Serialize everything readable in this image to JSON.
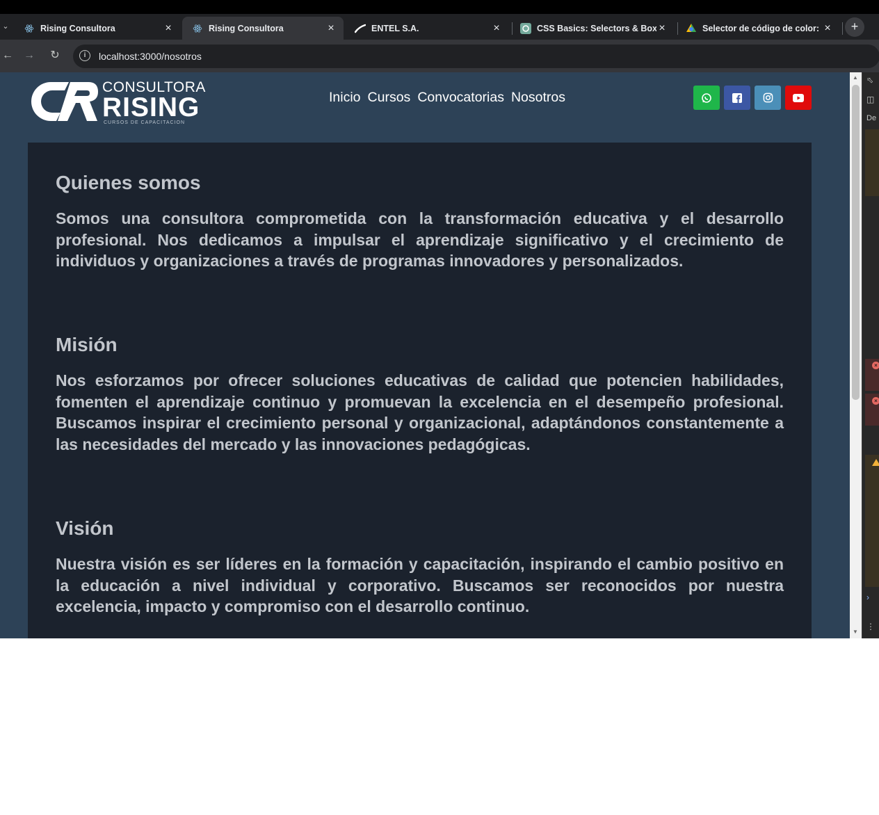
{
  "browser": {
    "tabs": [
      {
        "title": "Rising Consultora",
        "icon": "react-icon",
        "active": false
      },
      {
        "title": "Rising Consultora",
        "icon": "react-icon",
        "active": true
      },
      {
        "title": "ENTEL S.A.",
        "icon": "entel-icon",
        "active": false
      },
      {
        "title": "CSS Basics: Selectors & Box Mo",
        "icon": "chatgpt-icon",
        "active": false
      },
      {
        "title": "Selector de código de color: H",
        "icon": "color-picker-icon",
        "active": false
      }
    ],
    "new_tab": "+",
    "url": "localhost:3000/nosotros"
  },
  "site": {
    "logo": {
      "line1": "CONSULTORA",
      "line2": "RISING",
      "line3": "CURSOS DE CAPACITACION"
    },
    "nav": [
      "Inicio",
      "Cursos",
      "Convocatorias",
      "Nosotros"
    ],
    "social": [
      "whatsapp-icon",
      "facebook-icon",
      "instagram-icon",
      "youtube-icon"
    ],
    "colors": {
      "header_bg": "#2d4257",
      "content_bg": "#1b222d",
      "text": "#c2c6cc",
      "whatsapp": "#1fb64a",
      "facebook": "#3c57a4",
      "instagram": "#4b8fb8",
      "youtube": "#e00b0b"
    }
  },
  "sections": [
    {
      "heading": "Quienes somos",
      "text": "Somos una consultora comprometida con la transformación educativa y el desarrollo profesional. Nos dedicamos a impulsar el aprendizaje significativo y el crecimiento de individuos y organizaciones a través de programas innovadores y personalizados."
    },
    {
      "heading": "Misión",
      "text": "Nos esforzamos por ofrecer soluciones educativas de calidad que potencien habilidades, fomenten el aprendizaje continuo y promuevan la excelencia en el desempeño profesional. Buscamos inspirar el crecimiento personal y organizacional, adaptándonos constantemente a las necesidades del mercado y las innovaciones pedagógicas."
    },
    {
      "heading": "Visión",
      "text": "Nuestra visión es ser líderes en la formación y capacitación, inspirando el cambio positivo en la educación a nivel individual y corporativo. Buscamos ser reconocidos por nuestra excelencia, impacto y compromiso con el desarrollo continuo."
    }
  ],
  "devtools": {
    "label": "De"
  }
}
